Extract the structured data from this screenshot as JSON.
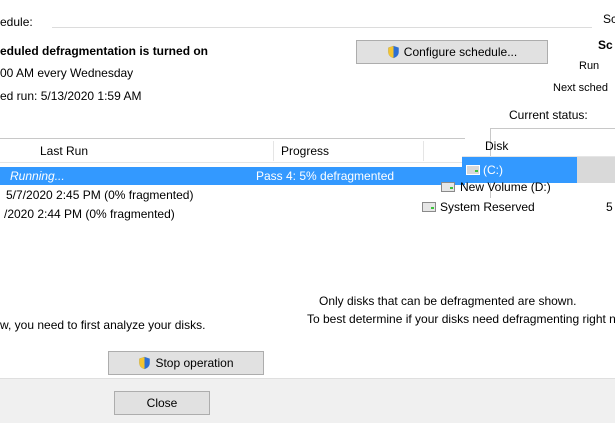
{
  "schedule": {
    "label_fragment": "edule:",
    "status": "eduled defragmentation is turned on",
    "when": "00 AM every Wednesday",
    "next_run": "ed run: 5/13/2020 1:59 AM",
    "configure_button": "Configure schedule..."
  },
  "right_panel": {
    "title_fragment": "Sc",
    "title_fragment_bold": "Sc",
    "current_run": "Run",
    "next_scheduled": "Next sched",
    "current_status_label": "Current status:"
  },
  "list": {
    "columns": [
      "Last Run",
      "Progress"
    ],
    "rows": [
      {
        "last_run": "Running...",
        "progress": "Pass 4: 5% defragmented",
        "selected": true
      },
      {
        "last_run": "5/7/2020 2:45 PM (0% fragmented)",
        "progress": "",
        "selected": false
      },
      {
        "last_run": "/2020 2:44 PM (0% fragmented)",
        "progress": "",
        "selected": false
      }
    ]
  },
  "disk_list": {
    "header": "Disk",
    "items": [
      {
        "name": "(C:)",
        "selected": true
      },
      {
        "name": "New Volume (D:)",
        "selected": false
      },
      {
        "name": "System Reserved",
        "selected": false,
        "extra": "5"
      }
    ]
  },
  "notes": {
    "only_disks": "Only disks that can be defragmented are shown.",
    "to_best": "To best determine if your disks need defragmenting right n",
    "left_fragment": "w, you need to first analyze your disks."
  },
  "buttons": {
    "stop": "Stop operation",
    "close": "Close"
  },
  "colors": {
    "selection": "#3399ff",
    "button_bg": "#e1e1e1",
    "button_border": "#adadad"
  }
}
